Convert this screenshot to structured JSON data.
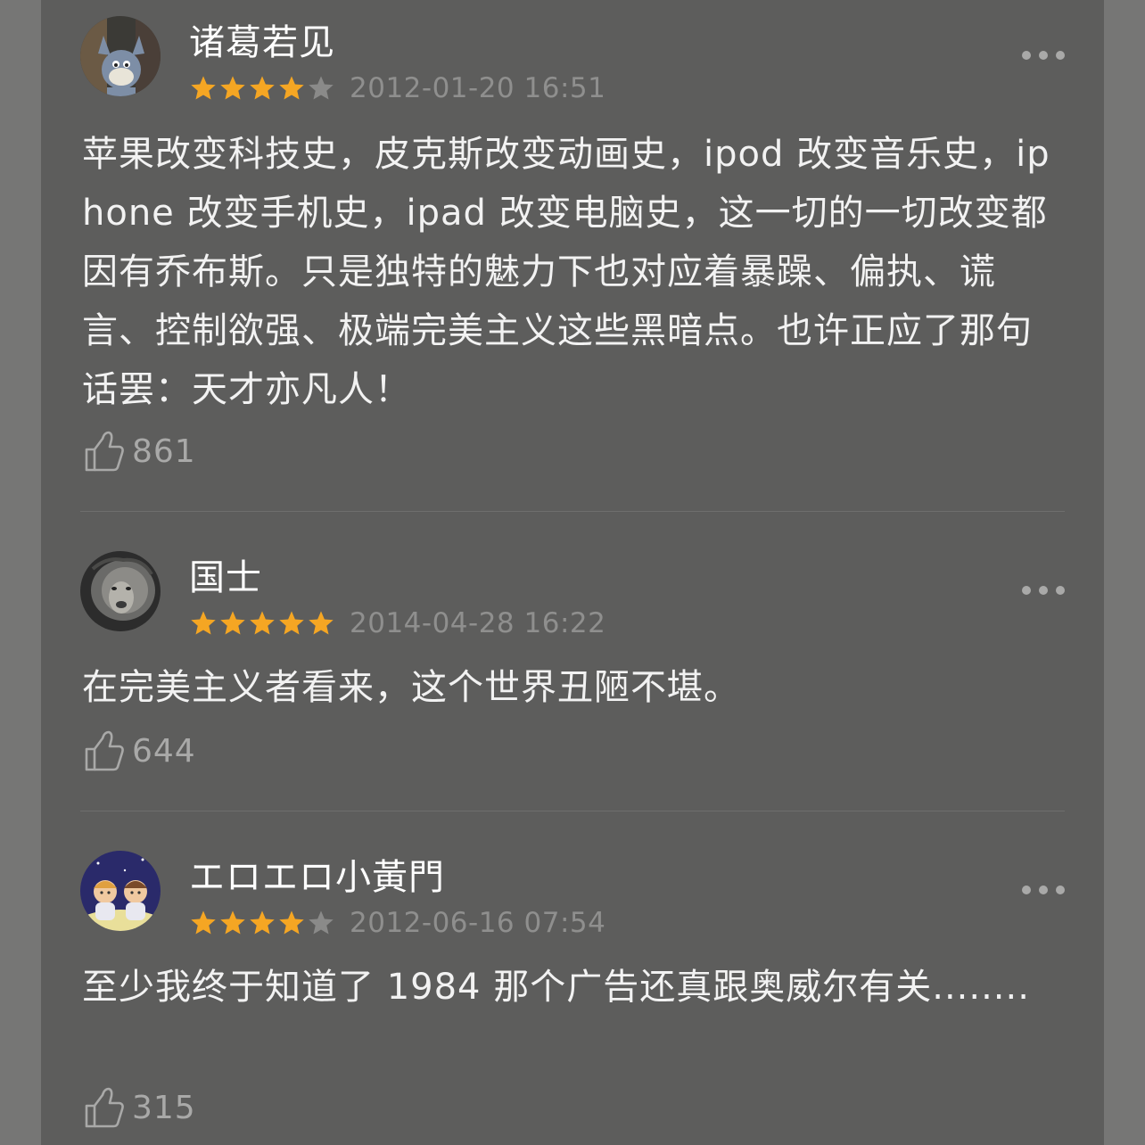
{
  "colors": {
    "star_on": "#f5a623",
    "star_off": "#8a8a89",
    "background": "#5d5d5c"
  },
  "comments": [
    {
      "username": "诸葛若见",
      "avatar_icon": "tom-cat-avatar",
      "rating": 4,
      "date": "2012-01-20 16:51",
      "text": "苹果改变科技史，皮克斯改变动画史，ipod 改变音乐史，iphone 改变手机史，ipad 改变电脑史，这一切的一切改变都因有乔布斯。只是独特的魅力下也对应着暴躁、偏执、谎言、控制欲强、极端完美主义这些黑暗点。也许正应了那句话罢：天才亦凡人！",
      "likes": "861"
    },
    {
      "username": "国士",
      "avatar_icon": "lion-avatar",
      "rating": 5,
      "date": "2014-04-28 16:22",
      "text": "在完美主义者看来，这个世界丑陋不堪。",
      "likes": "644"
    },
    {
      "username": "エロエロ小黃門",
      "avatar_icon": "astronaut-kids-avatar",
      "rating": 4,
      "date": "2012-06-16 07:54",
      "text": "至少我终于知道了 1984 那个广告还真跟奥威尔有关........",
      "likes": "315"
    }
  ]
}
